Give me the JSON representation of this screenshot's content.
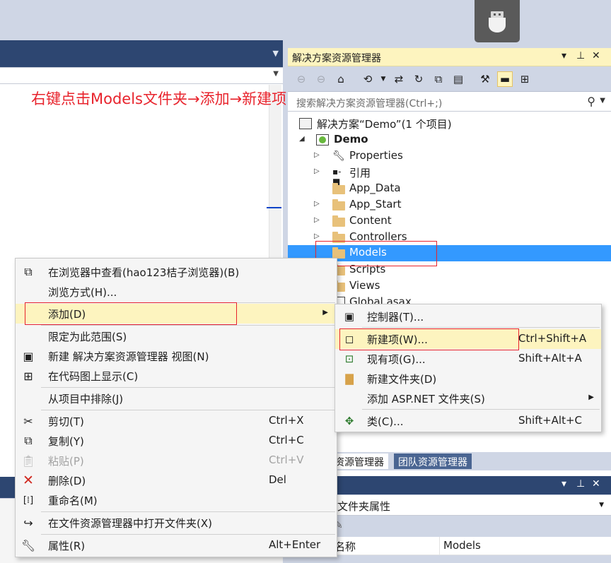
{
  "annotation": "右键点击Models文件夹→添加→新建项",
  "solution_explorer": {
    "title": "解决方案资源管理器",
    "title_controls": [
      "▾",
      "⊥",
      "✕"
    ],
    "search_placeholder": "搜索解决方案资源管理器(Ctrl+;)",
    "tree": [
      {
        "label": "解决方案“Demo”(1 个项目)",
        "icon": "solution-icon"
      },
      {
        "label": "Demo",
        "icon": "web-project-icon",
        "bold": true
      },
      {
        "label": "Properties",
        "icon": "wrench-icon"
      },
      {
        "label": "引用",
        "icon": "references-icon"
      },
      {
        "label": "App_Data",
        "icon": "folder-icon"
      },
      {
        "label": "App_Start",
        "icon": "folder-icon"
      },
      {
        "label": "Content",
        "icon": "folder-icon"
      },
      {
        "label": "Controllers",
        "icon": "folder-icon"
      },
      {
        "label": "Models",
        "icon": "folder-icon",
        "selected": true
      },
      {
        "label": "Scripts",
        "icon": "folder-icon"
      },
      {
        "label": "Views",
        "icon": "folder-icon"
      },
      {
        "label": "Global.asax",
        "icon": "file-icon"
      }
    ],
    "tabs": [
      {
        "label": "资源管理器",
        "active": true
      },
      {
        "label": "团队资源管理器",
        "active": false
      }
    ]
  },
  "properties": {
    "title_controls": [
      "▾",
      "⊥",
      "✕"
    ],
    "combo_text": "文件夹属性",
    "row_key": "名称",
    "row_value": "Models"
  },
  "context_menu": {
    "items": [
      {
        "label": "在浏览器中查看(hao123桔子浏览器)(B)",
        "icon": "browser-view-icon"
      },
      {
        "label": "浏览方式(H)...",
        "icon": ""
      },
      {
        "label": "添加(D)",
        "icon": "",
        "submenu": true,
        "highlighted": true
      },
      {
        "label": "限定为此范围(S)",
        "icon": ""
      },
      {
        "label": "新建 解决方案资源管理器 视图(N)",
        "icon": "new-view-icon"
      },
      {
        "label": "在代码图上显示(C)",
        "icon": "code-map-icon"
      },
      {
        "label": "从项目中排除(J)",
        "icon": ""
      },
      {
        "label": "剪切(T)",
        "shortcut": "Ctrl+X",
        "icon": "scissors-icon"
      },
      {
        "label": "复制(Y)",
        "shortcut": "Ctrl+C",
        "icon": "copy-icon"
      },
      {
        "label": "粘贴(P)",
        "shortcut": "Ctrl+V",
        "icon": "paste-icon",
        "disabled": true
      },
      {
        "label": "删除(D)",
        "shortcut": "Del",
        "icon": "delete-icon"
      },
      {
        "label": "重命名(M)",
        "icon": "rename-icon"
      },
      {
        "label": "在文件资源管理器中打开文件夹(X)",
        "icon": "open-folder-icon"
      },
      {
        "label": "属性(R)",
        "shortcut": "Alt+Enter",
        "icon": "wrench-icon"
      }
    ]
  },
  "submenu": {
    "items": [
      {
        "label": "控制器(T)...",
        "icon": "controller-icon"
      },
      {
        "label": "新建项(W)...",
        "shortcut": "Ctrl+Shift+A",
        "icon": "new-item-icon",
        "highlighted": true
      },
      {
        "label": "现有项(G)...",
        "shortcut": "Shift+Alt+A",
        "icon": "existing-item-icon"
      },
      {
        "label": "新建文件夹(D)",
        "icon": "new-folder-icon"
      },
      {
        "label": "添加 ASP.NET 文件夹(S)",
        "icon": "",
        "submenu": true
      },
      {
        "label": "类(C)...",
        "shortcut": "Shift+Alt+C",
        "icon": "class-icon"
      }
    ]
  },
  "colors": {
    "accent_blue": "#3399ff",
    "highlight": "#fdf4bf",
    "annotation_red": "#e8232c",
    "header_dark": "#2d4671"
  }
}
